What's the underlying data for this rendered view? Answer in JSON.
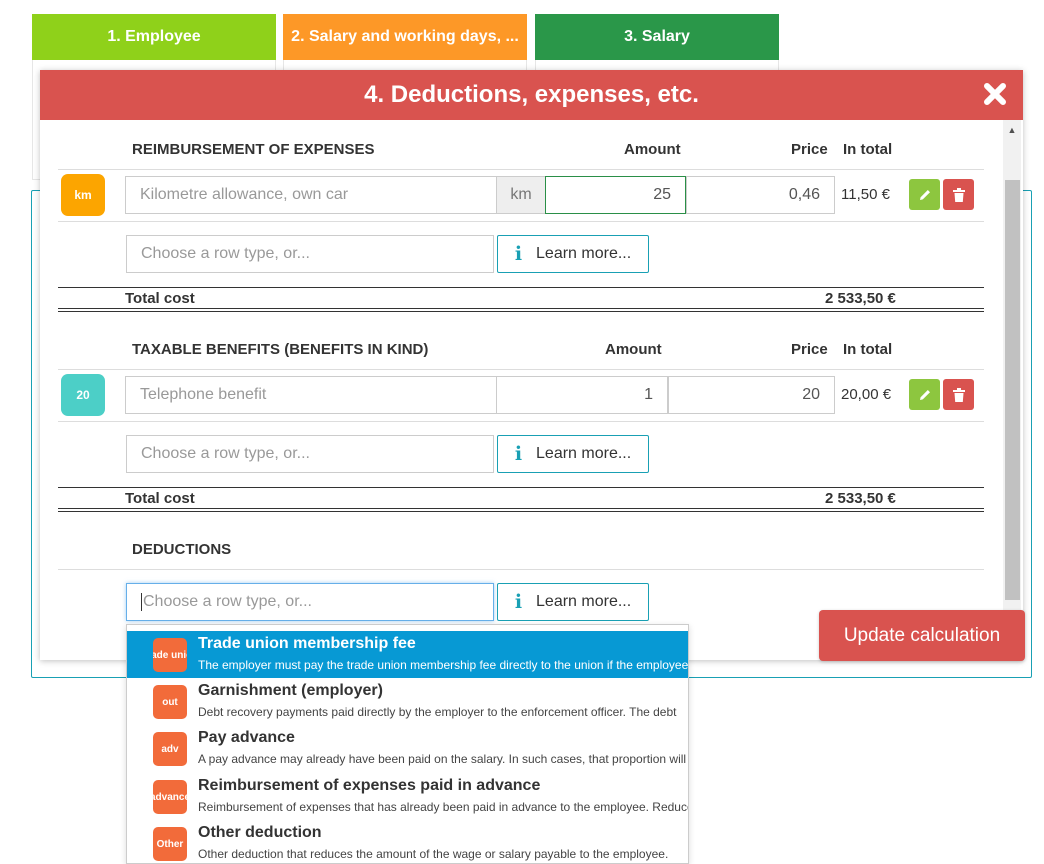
{
  "steps": [
    {
      "label": "1. Employee",
      "color": "#8fd11a"
    },
    {
      "label": "2. Salary and working days, ...",
      "color": "#fd9827"
    },
    {
      "label": "3. Salary",
      "color": "#2a9749"
    }
  ],
  "modal": {
    "title": "4. Deductions, expenses, etc.",
    "header_color": "#d9534f",
    "close_icon": "close-icon"
  },
  "expenses": {
    "title": "REIMBURSEMENT OF EXPENSES",
    "col_amount": "Amount",
    "col_price": "Price",
    "col_total": "In total",
    "row": {
      "badge": "km",
      "badge_color": "#fca500",
      "name": "Kilometre allowance, own car",
      "unit": "km",
      "amount": "25",
      "price": "0,46",
      "total": "11,50 €"
    },
    "chooser_placeholder": "Choose a row type, or...",
    "learn_more": "Learn more...",
    "total_label": "Total cost",
    "total_value": "2 533,50 €"
  },
  "benefits": {
    "title": "TAXABLE BENEFITS (BENEFITS IN KIND)",
    "col_amount": "Amount",
    "col_price": "Price",
    "col_total": "In total",
    "row": {
      "badge": "20",
      "badge_color": "#4ccfc7",
      "name": "Telephone benefit",
      "amount": "1",
      "price": "20",
      "total": "20,00 €"
    },
    "chooser_placeholder": "Choose a row type, or...",
    "learn_more": "Learn more...",
    "total_label": "Total cost",
    "total_value": "2 533,50 €"
  },
  "deductions": {
    "title": "DEDUCTIONS",
    "chooser_placeholder": "Choose a row type, or...",
    "learn_more": "Learn more..."
  },
  "update_button": "Update calculation",
  "dropdown": [
    {
      "badge": "Trade union",
      "title": "Trade union membership fee",
      "desc": "The employer must pay the trade union membership fee directly to the union if the employee",
      "active": true
    },
    {
      "badge": "out",
      "title": "Garnishment (employer)",
      "desc": "Debt recovery payments paid directly by the employer to the enforcement officer. The debt",
      "active": false
    },
    {
      "badge": "adv",
      "title": "Pay advance",
      "desc": "A pay advance may already have been paid on the salary. In such cases, that proportion will",
      "active": false
    },
    {
      "badge": "advance",
      "title": "Reimbursement of expenses paid in advance",
      "desc": "Reimbursement of expenses that has already been paid in advance to the employee. Reduces",
      "active": false
    },
    {
      "badge": "Other",
      "title": "Other deduction",
      "desc": "Other deduction that reduces the amount of the wage or salary payable to the employee.",
      "active": false
    }
  ]
}
